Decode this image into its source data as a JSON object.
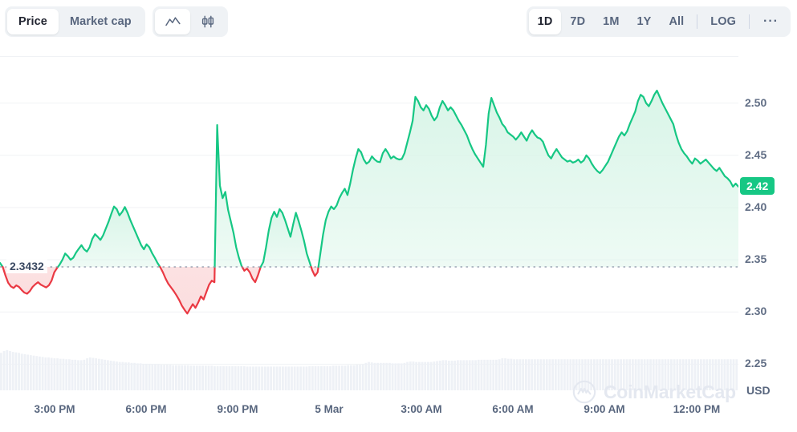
{
  "toolbar": {
    "metric_tabs": [
      {
        "label": "Price",
        "active": true
      },
      {
        "label": "Market cap",
        "active": false
      }
    ],
    "chart_type_icons": [
      {
        "name": "line-chart-icon",
        "active": true
      },
      {
        "name": "candlestick-chart-icon",
        "active": false
      }
    ],
    "ranges": [
      {
        "label": "1D",
        "active": true
      },
      {
        "label": "7D",
        "active": false
      },
      {
        "label": "1M",
        "active": false
      },
      {
        "label": "1Y",
        "active": false
      },
      {
        "label": "All",
        "active": false
      }
    ],
    "log_label": "LOG",
    "more_label": "···"
  },
  "watermark": "CoinMarketCap",
  "chart_data": {
    "type": "area",
    "title": "",
    "xlabel": "",
    "ylabel": "USD",
    "currency": "USD",
    "ylim": [
      2.225,
      2.545
    ],
    "grid": true,
    "legend": "none",
    "y_ticks": [
      "2.50",
      "2.45",
      "2.40",
      "2.35",
      "2.30",
      "2.25"
    ],
    "y_tick_values": [
      2.5,
      2.45,
      2.4,
      2.35,
      2.3,
      2.25
    ],
    "x_ticks": [
      "3:00 PM",
      "6:00 PM",
      "9:00 PM",
      "5 Mar",
      "3:00 AM",
      "6:00 AM",
      "9:00 AM",
      "12:00 PM"
    ],
    "x_tick_positions": [
      68,
      182,
      296,
      410,
      525,
      639,
      753,
      868
    ],
    "baseline_value": 2.3432,
    "baseline_label": "2.3432",
    "current_price": 2.42,
    "current_price_label": "2.42",
    "colors": {
      "up_line": "#16c784",
      "up_fill": "#d9f5e8",
      "down_line": "#ea3943",
      "down_fill": "#fbdcdd",
      "grid": "#f0f2f5",
      "axis_text": "#616e85",
      "badge": "#16c784",
      "volume_bar": "#eef1f6"
    },
    "values": [
      2.347,
      2.3432,
      2.335,
      2.328,
      2.3245,
      2.323,
      2.3255,
      2.324,
      2.321,
      2.3185,
      2.3175,
      2.32,
      2.324,
      2.3265,
      2.3285,
      2.3262,
      2.3248,
      2.3235,
      2.3255,
      2.33,
      2.338,
      2.342,
      2.3455,
      2.35,
      2.356,
      2.3535,
      2.35,
      2.352,
      2.3568,
      2.3605,
      2.364,
      2.36,
      2.3578,
      2.362,
      2.37,
      2.3745,
      2.372,
      2.369,
      2.3735,
      2.38,
      2.3865,
      2.394,
      2.401,
      2.3985,
      2.3925,
      2.3958,
      2.4005,
      2.395,
      2.388,
      2.382,
      2.376,
      2.37,
      2.364,
      2.36,
      2.3648,
      2.362,
      2.3565,
      2.352,
      2.347,
      2.343,
      2.338,
      2.332,
      2.327,
      2.3235,
      2.32,
      2.316,
      2.3115,
      2.306,
      2.302,
      2.2985,
      2.303,
      2.3075,
      2.304,
      2.309,
      2.315,
      2.312,
      2.319,
      2.326,
      2.33,
      2.3285,
      2.479,
      2.421,
      2.409,
      2.415,
      2.398,
      2.387,
      2.376,
      2.362,
      2.352,
      2.344,
      2.3395,
      2.3415,
      2.338,
      2.332,
      2.3285,
      2.335,
      2.343,
      2.348,
      2.362,
      2.378,
      2.39,
      2.396,
      2.391,
      2.3985,
      2.395,
      2.388,
      2.38,
      2.372,
      2.384,
      2.395,
      2.387,
      2.378,
      2.368,
      2.356,
      2.348,
      2.34,
      2.3345,
      2.338,
      2.356,
      2.374,
      2.388,
      2.396,
      2.401,
      2.3985,
      2.402,
      2.409,
      2.414,
      2.418,
      2.412,
      2.423,
      2.436,
      2.447,
      2.456,
      2.453,
      2.446,
      2.442,
      2.444,
      2.449,
      2.446,
      2.444,
      2.4435,
      2.452,
      2.456,
      2.452,
      2.447,
      2.449,
      2.447,
      2.446,
      2.4465,
      2.452,
      2.462,
      2.472,
      2.483,
      2.506,
      2.502,
      2.496,
      2.493,
      2.498,
      2.4945,
      2.488,
      2.4835,
      2.487,
      2.496,
      2.502,
      2.498,
      2.493,
      2.496,
      2.493,
      2.488,
      2.483,
      2.479,
      2.474,
      2.469,
      2.462,
      2.456,
      2.451,
      2.447,
      2.443,
      2.439,
      2.46,
      2.49,
      2.505,
      2.498,
      2.491,
      2.486,
      2.48,
      2.477,
      2.472,
      2.47,
      2.468,
      2.465,
      2.468,
      2.472,
      2.468,
      2.464,
      2.47,
      2.474,
      2.47,
      2.467,
      2.466,
      2.463,
      2.456,
      2.45,
      2.447,
      2.452,
      2.456,
      2.452,
      2.448,
      2.446,
      2.444,
      2.445,
      2.443,
      2.444,
      2.446,
      2.443,
      2.445,
      2.45,
      2.447,
      2.442,
      2.438,
      2.435,
      2.433,
      2.436,
      2.44,
      2.444,
      2.45,
      2.456,
      2.462,
      2.468,
      2.472,
      2.469,
      2.473,
      2.48,
      2.486,
      2.492,
      2.502,
      2.508,
      2.506,
      2.5,
      2.497,
      2.502,
      2.508,
      2.512,
      2.506,
      2.5,
      2.495,
      2.49,
      2.485,
      2.48,
      2.47,
      2.462,
      2.456,
      2.452,
      2.449,
      2.445,
      2.442,
      2.447,
      2.445,
      2.442,
      2.444,
      2.446,
      2.443,
      2.44,
      2.437,
      2.435,
      2.438,
      2.434,
      2.43,
      2.428,
      2.425,
      2.42,
      2.423,
      2.42
    ],
    "volume_profile": [
      0.82,
      0.86,
      0.88,
      0.86,
      0.84,
      0.83,
      0.82,
      0.8,
      0.79,
      0.78,
      0.77,
      0.76,
      0.75,
      0.74,
      0.73,
      0.72,
      0.72,
      0.71,
      0.7,
      0.7,
      0.69,
      0.69,
      0.68,
      0.68,
      0.67,
      0.67,
      0.66,
      0.66,
      0.67,
      0.7,
      0.72,
      0.71,
      0.7,
      0.69,
      0.68,
      0.67,
      0.66,
      0.65,
      0.64,
      0.63,
      0.62,
      0.62,
      0.61,
      0.61,
      0.6,
      0.6,
      0.59,
      0.59,
      0.58,
      0.58,
      0.58,
      0.57,
      0.57,
      0.57,
      0.56,
      0.56,
      0.56,
      0.56,
      0.55,
      0.55,
      0.55,
      0.55,
      0.55,
      0.55,
      0.54,
      0.54,
      0.54,
      0.54,
      0.54,
      0.54,
      0.54,
      0.54,
      0.53,
      0.53,
      0.53,
      0.53,
      0.53,
      0.53,
      0.53,
      0.53,
      0.53,
      0.53,
      0.53,
      0.52,
      0.52,
      0.52,
      0.52,
      0.52,
      0.52,
      0.52,
      0.52,
      0.52,
      0.52,
      0.52,
      0.52,
      0.52,
      0.52,
      0.52,
      0.52,
      0.52,
      0.52,
      0.52,
      0.52,
      0.52,
      0.53,
      0.53,
      0.53,
      0.53,
      0.53,
      0.53,
      0.53,
      0.53,
      0.54,
      0.54,
      0.54,
      0.54,
      0.54,
      0.55,
      0.55,
      0.55,
      0.56,
      0.56,
      0.57,
      0.6,
      0.62,
      0.61,
      0.6,
      0.6,
      0.6,
      0.6,
      0.6,
      0.6,
      0.59,
      0.59,
      0.59,
      0.59,
      0.6,
      0.62,
      0.63,
      0.63,
      0.62,
      0.62,
      0.62,
      0.62,
      0.62,
      0.62,
      0.63,
      0.64,
      0.65,
      0.66,
      0.66,
      0.65,
      0.65,
      0.65,
      0.66,
      0.66,
      0.66,
      0.66,
      0.66,
      0.66,
      0.66,
      0.67,
      0.67,
      0.67,
      0.67,
      0.67,
      0.67,
      0.67,
      0.68,
      0.7,
      0.7,
      0.69,
      0.69,
      0.68,
      0.68,
      0.68,
      0.68,
      0.68,
      0.68,
      0.68,
      0.68,
      0.68,
      0.68,
      0.68,
      0.68,
      0.68,
      0.68,
      0.68,
      0.68,
      0.68,
      0.68,
      0.68,
      0.68,
      0.68,
      0.68,
      0.68,
      0.68,
      0.68,
      0.68,
      0.68,
      0.68,
      0.68,
      0.68,
      0.68,
      0.68,
      0.68,
      0.68,
      0.68,
      0.68,
      0.68,
      0.68,
      0.68,
      0.68,
      0.68,
      0.68,
      0.68,
      0.68,
      0.68,
      0.68,
      0.68,
      0.68,
      0.68,
      0.68,
      0.68,
      0.68,
      0.68,
      0.68,
      0.68,
      0.68,
      0.68,
      0.68,
      0.68,
      0.68,
      0.68,
      0.68,
      0.68,
      0.68,
      0.68,
      0.68,
      0.68,
      0.68,
      0.68,
      0.68,
      0.68,
      0.68,
      0.68,
      0.68,
      0.68,
      0.68
    ]
  }
}
